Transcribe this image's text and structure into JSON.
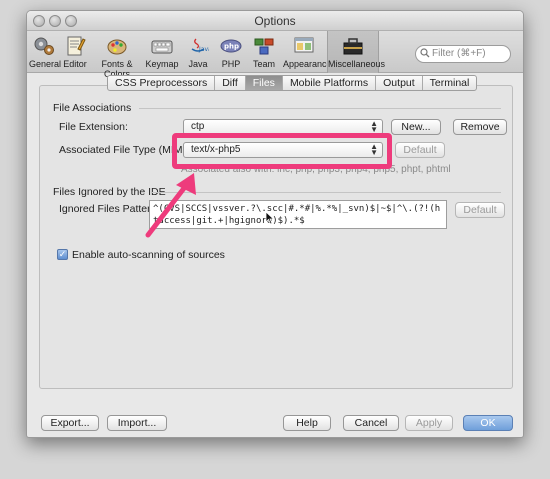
{
  "window": {
    "title": "Options"
  },
  "toolbar": {
    "items": [
      {
        "label": "General",
        "icon": "gears-icon"
      },
      {
        "label": "Editor",
        "icon": "editor-icon"
      },
      {
        "label": "Fonts & Colors",
        "icon": "palette-icon"
      },
      {
        "label": "Keymap",
        "icon": "keyboard-icon"
      },
      {
        "label": "Java",
        "icon": "java-icon"
      },
      {
        "label": "PHP",
        "icon": "php-icon"
      },
      {
        "label": "Team",
        "icon": "team-icon"
      },
      {
        "label": "Appearance",
        "icon": "appearance-icon"
      },
      {
        "label": "Miscellaneous",
        "icon": "toolbox-icon"
      }
    ],
    "filter_placeholder": "Filter (⌘+F)"
  },
  "tabs": [
    "CSS Preprocessors",
    "Diff",
    "Files",
    "Mobile Platforms",
    "Output",
    "Terminal"
  ],
  "file_associations": {
    "section_title": "File Associations",
    "extension_label": "File Extension:",
    "extension_value": "ctp",
    "new_button": "New...",
    "remove_button": "Remove",
    "mime_label": "Associated File Type (MIME):",
    "mime_value": "text/x-php5",
    "default_button": "Default",
    "associated_hint": "Associated also with: inc, php, php3, php4, php5, phpt, phtml"
  },
  "files_ignored": {
    "section_title": "Files Ignored by the IDE",
    "pattern_label": "Ignored Files Pattern:",
    "pattern_value": "^(CVS|SCCS|vssver.?\\.scc|#.*#|%.*%|_svn)$|~$|^\\.(?!(htaccess|git.+|hgignore)$).*$",
    "default_button": "Default"
  },
  "auto_scan": {
    "label": "Enable auto-scanning of sources",
    "checked": true
  },
  "footer": {
    "export_button": "Export...",
    "import_button": "Import...",
    "help_button": "Help",
    "cancel_button": "Cancel",
    "apply_button": "Apply",
    "ok_button": "OK"
  },
  "colors": {
    "highlight": "#ee3b7c",
    "accent": "#6f9fda"
  }
}
